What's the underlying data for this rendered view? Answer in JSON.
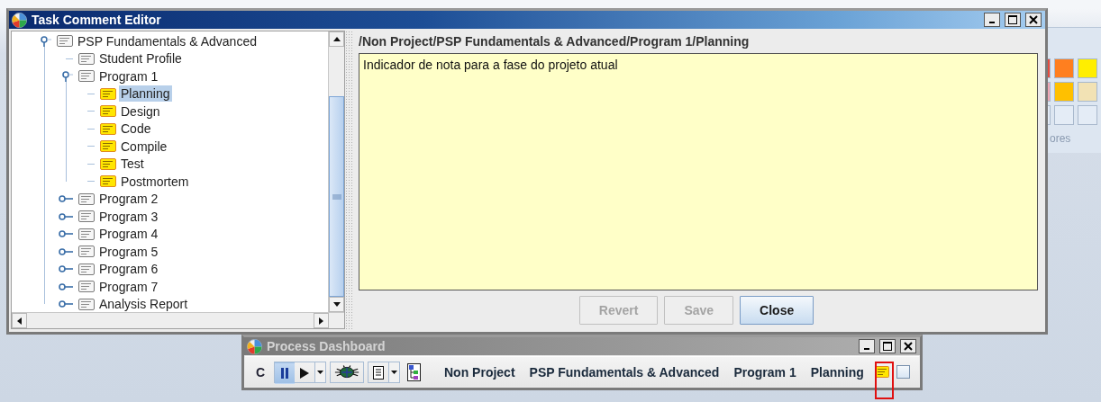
{
  "background_app": {
    "swatches": [
      {
        "color": "#e84a3c"
      },
      {
        "color": "#ff7f1f"
      },
      {
        "color": "#ffee00"
      },
      {
        "color": "#f2a6b4"
      },
      {
        "color": "#ffc000"
      },
      {
        "color": "#f2e2b4"
      },
      {
        "color": "#e4ecf6"
      },
      {
        "color": "#e4ecf6"
      },
      {
        "color": "#e4ecf6"
      }
    ],
    "caption": "ores"
  },
  "editor": {
    "title": "Task Comment Editor",
    "active": true,
    "tree": [
      {
        "label": "PSP Fundamentals & Advanced",
        "kind": "plain",
        "expanded": true,
        "selected": false,
        "children": [
          {
            "label": "Student Profile",
            "kind": "plain",
            "selected": false
          },
          {
            "label": "Program 1",
            "kind": "plain",
            "expanded": true,
            "selected": false,
            "children": [
              {
                "label": "Planning",
                "kind": "commented",
                "selected": true
              },
              {
                "label": "Design",
                "kind": "commented",
                "selected": false
              },
              {
                "label": "Code",
                "kind": "commented",
                "selected": false
              },
              {
                "label": "Compile",
                "kind": "commented",
                "selected": false
              },
              {
                "label": "Test",
                "kind": "commented",
                "selected": false
              },
              {
                "label": "Postmortem",
                "kind": "commented",
                "selected": false
              }
            ]
          },
          {
            "label": "Program 2",
            "kind": "plain",
            "expanded": false,
            "selected": false
          },
          {
            "label": "Program 3",
            "kind": "plain",
            "expanded": false,
            "selected": false
          },
          {
            "label": "Program 4",
            "kind": "plain",
            "expanded": false,
            "selected": false
          },
          {
            "label": "Program 5",
            "kind": "plain",
            "expanded": false,
            "selected": false
          },
          {
            "label": "Program 6",
            "kind": "plain",
            "expanded": false,
            "selected": false
          },
          {
            "label": "Program 7",
            "kind": "plain",
            "expanded": false,
            "selected": false
          },
          {
            "label": "Analysis Report",
            "kind": "plain",
            "expanded": false,
            "selected": false
          }
        ]
      }
    ],
    "path": "/Non Project/PSP Fundamentals & Advanced/Program 1/Planning",
    "comment": "Indicador de nota para a fase do projeto atual",
    "buttons": [
      {
        "label": "Revert",
        "disabled": true
      },
      {
        "label": "Save",
        "disabled": true
      },
      {
        "label": "Close",
        "disabled": false
      }
    ]
  },
  "dashboard": {
    "title": "Process Dashboard",
    "active": false,
    "c_button": "C",
    "timer_paused": true,
    "path": [
      "Non Project",
      "PSP Fundamentals & Advanced",
      "Program 1",
      "Planning"
    ],
    "has_comment": true,
    "comment_highlighted": true,
    "completed": false
  }
}
